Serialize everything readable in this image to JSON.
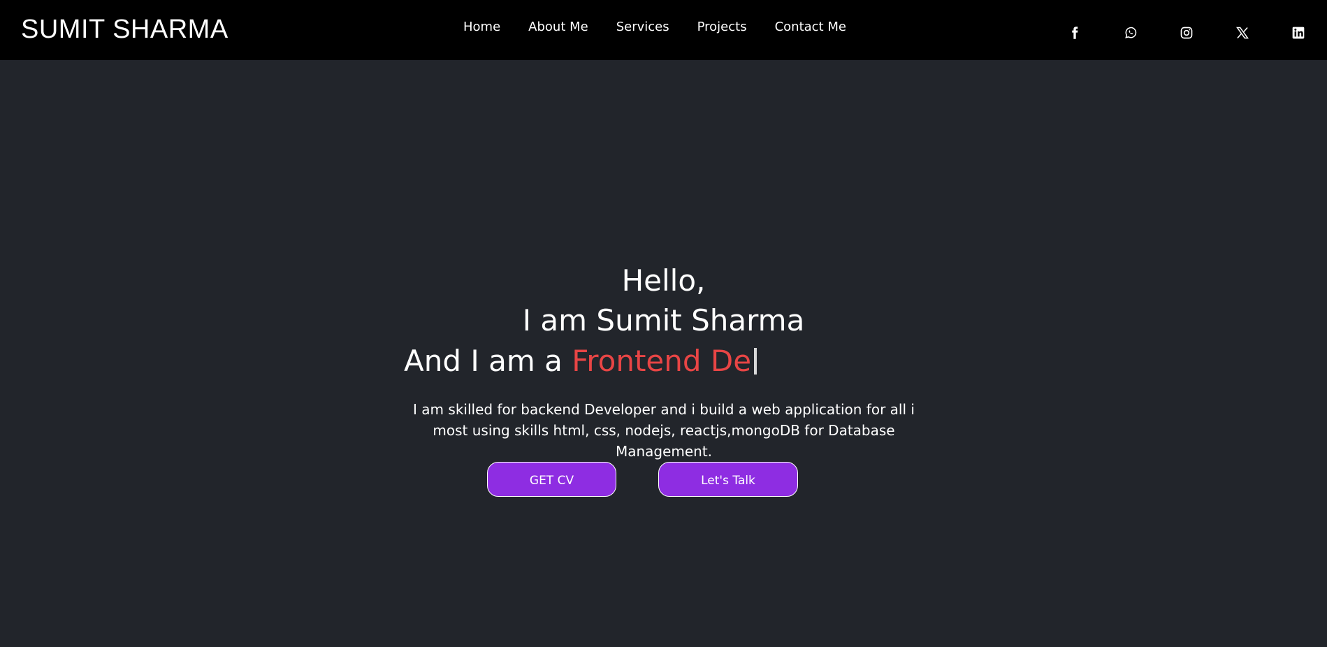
{
  "brand": "SUMIT SHARMA",
  "nav": {
    "items": [
      "Home",
      "About Me",
      "Services",
      "Projects",
      "Contact Me"
    ]
  },
  "socials": [
    "facebook-icon",
    "whatsapp-icon",
    "instagram-icon",
    "x-icon",
    "linkedin-icon"
  ],
  "hero": {
    "greeting": "Hello,",
    "name_line": "I am Sumit Sharma",
    "role_prefix": "And I am a ",
    "role_typed": "Frontend De",
    "description": "I am skilled for backend Developer and i build a web application for all i most using skills html, css, nodejs, reactjs,mongoDB for Database Management.",
    "cv_button": "GET CV",
    "talk_button": "Let's Talk"
  },
  "colors": {
    "navbar_bg": "#000000",
    "page_bg": "#22252b",
    "accent_red": "#e84545",
    "button_purple": "#8e2de2"
  }
}
